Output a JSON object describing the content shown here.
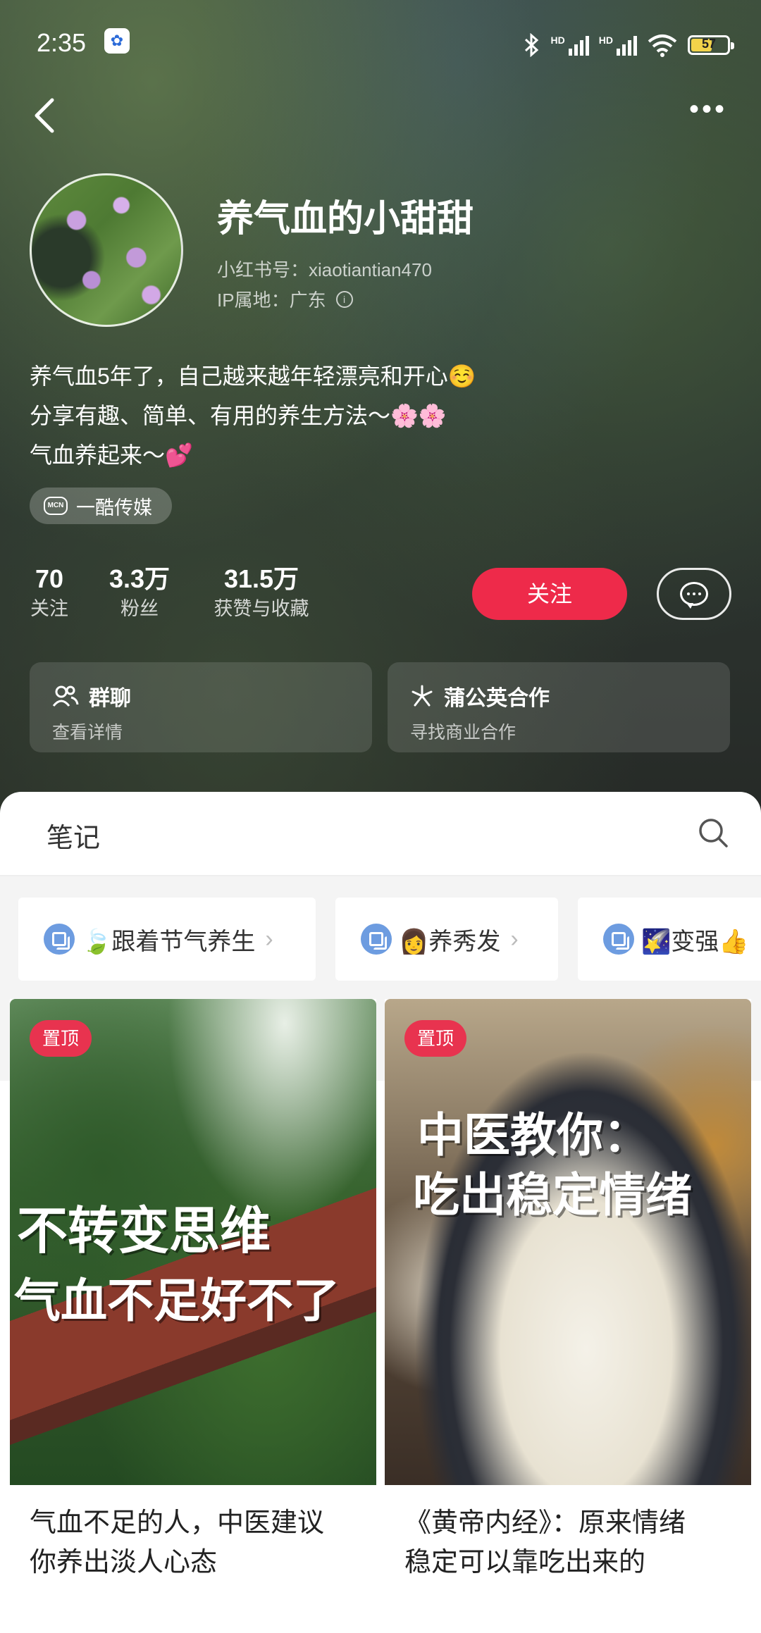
{
  "status": {
    "time": "2:35",
    "battery": "57"
  },
  "profile": {
    "nickname": "养气血的小甜甜",
    "red_id": "小红书号：xiaotiantian470",
    "ip_location": "IP属地：广东",
    "bio": [
      "养气血5年了，自己越来越年轻漂亮和开心☺️",
      "分享有趣、简单、有用的养生方法～🌸🌸",
      "气血养起来～💕"
    ],
    "mcn_label": "一酷传媒"
  },
  "stats": [
    {
      "value": "70",
      "label": "关注"
    },
    {
      "value": "3.3万",
      "label": "粉丝"
    },
    {
      "value": "31.5万",
      "label": "获赞与收藏"
    }
  ],
  "actions": {
    "follow_label": "关注"
  },
  "cards": [
    {
      "title": "群聊",
      "subtitle": "查看详情",
      "icon": "group-icon"
    },
    {
      "title": "蒲公英合作",
      "subtitle": "寻找商业合作",
      "icon": "dandelion-icon"
    }
  ],
  "tabs": {
    "notes_label": "笔记"
  },
  "collections": [
    {
      "label": "🍃跟着节气养生"
    },
    {
      "label": "👩养秀发"
    },
    {
      "label": "🌠变强👍"
    }
  ],
  "posts": [
    {
      "badge": "置顶",
      "overlay_lines": [
        "不转变思维",
        "气血不足好不了"
      ],
      "title_lines": [
        "气血不足的人，中医建议",
        "你养出淡人心态"
      ]
    },
    {
      "badge": "置顶",
      "overlay_lines": [
        "中医教你：",
        "吃出稳定情绪"
      ],
      "title_lines": [
        "《黄帝内经》：原来情绪",
        "稳定可以靠吃出来的"
      ]
    }
  ],
  "colors": {
    "accent": "#ee2a4a",
    "pin": "#e8334f",
    "collection_icon": "#6d9ce0"
  }
}
